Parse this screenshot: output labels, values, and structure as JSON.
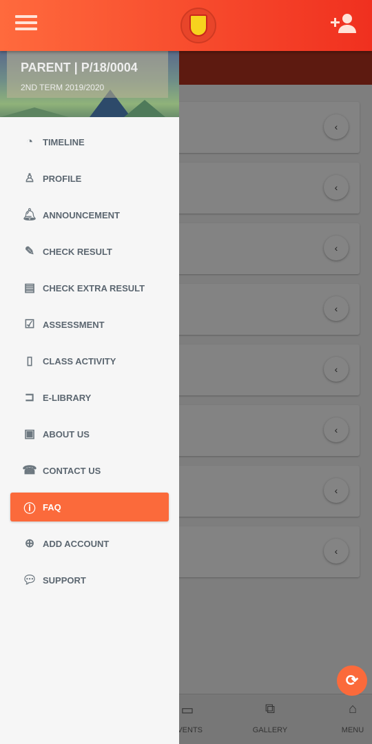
{
  "header": {
    "menu_icon": "hamburger-icon",
    "logo_icon": "school-crest",
    "add_user_icon": "user-plus-icon"
  },
  "drawer": {
    "profile": {
      "name": "PARENT | P/18/0004",
      "term": "2ND TERM 2019/2020"
    },
    "items": [
      {
        "label": "TIMELINE",
        "icon": "dashboard-icon",
        "glyph": "◔"
      },
      {
        "label": "PROFILE",
        "icon": "user-pin-icon",
        "glyph": "♙"
      },
      {
        "label": "ANNOUNCEMENT",
        "icon": "bell-icon",
        "glyph": "🔔︎"
      },
      {
        "label": "CHECK RESULT",
        "icon": "edit-icon",
        "glyph": "✎"
      },
      {
        "label": "CHECK EXTRA RESULT",
        "icon": "newspaper-icon",
        "glyph": "▤"
      },
      {
        "label": "ASSESSMENT",
        "icon": "check-square-icon",
        "glyph": "☑"
      },
      {
        "label": "CLASS ACTIVITY",
        "icon": "file-icon",
        "glyph": "▯"
      },
      {
        "label": "E-LIBRARY",
        "icon": "folder-open-icon",
        "glyph": "⊐"
      },
      {
        "label": "ABOUT US",
        "icon": "id-card-icon",
        "glyph": "▣"
      },
      {
        "label": "CONTACT US",
        "icon": "phone-square-icon",
        "glyph": "☎"
      },
      {
        "label": "FAQ",
        "icon": "info-circle-icon",
        "glyph": "ⓘ",
        "active": true
      },
      {
        "label": "ADD ACCOUNT",
        "icon": "plus-circle-icon",
        "glyph": "⊕"
      },
      {
        "label": "SUPPORT",
        "icon": "comments-icon",
        "glyph": "💬︎"
      }
    ]
  },
  "bottom_nav": [
    {
      "label": "EVENTS",
      "icon": "calendar-icon",
      "glyph": "▭"
    },
    {
      "label": "GALLERY",
      "icon": "image-icon",
      "glyph": "⧉"
    },
    {
      "label": "MENU",
      "icon": "home-icon",
      "glyph": "⌂"
    }
  ],
  "chevron_glyph": "‹",
  "refresh_glyph": "⟳",
  "colors": {
    "accent": "#fb6a3b",
    "header_start": "#ff6a3d",
    "header_end": "#f0301f"
  }
}
